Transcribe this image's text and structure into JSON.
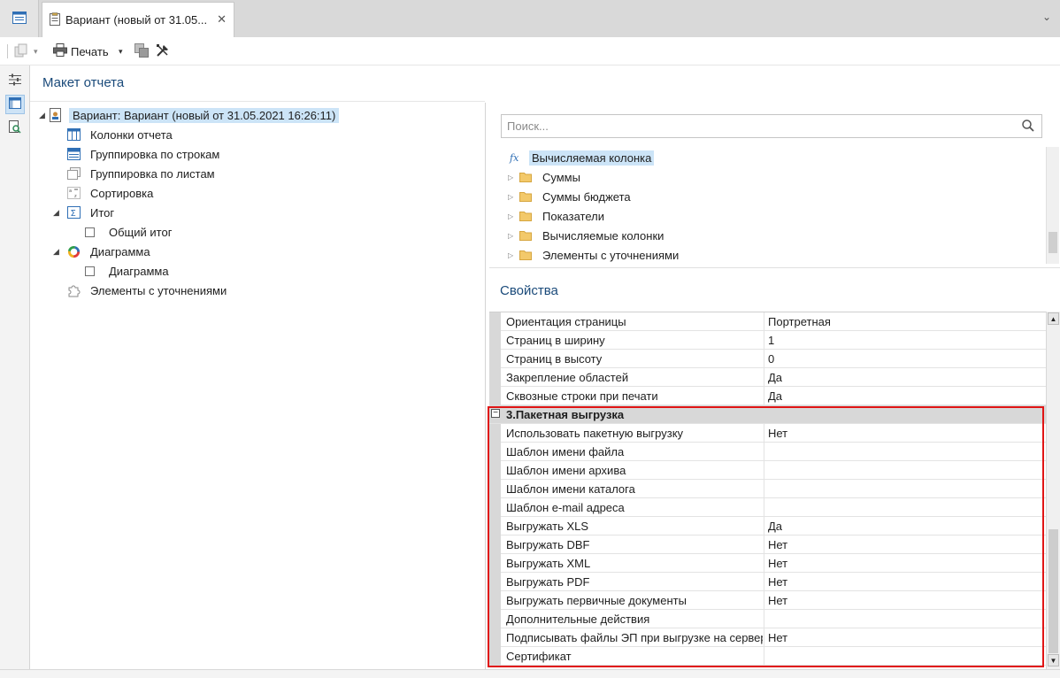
{
  "tabs": {
    "active_title": "Вариант (новый от 31.05...",
    "close_symbol": "✕",
    "chevron": "⌄"
  },
  "toolbar": {
    "print_label": "Печать",
    "dropdown_symbol": "▾"
  },
  "left_panel": {
    "title": "Макет отчета",
    "root": {
      "label": "Вариант: Вариант (новый от 31.05.2021 16:26:11)"
    },
    "items": [
      {
        "label": "Колонки отчета",
        "icon": "columns-icon"
      },
      {
        "label": "Группировка по строкам",
        "icon": "row-grouping-icon"
      },
      {
        "label": "Группировка по листам",
        "icon": "sheet-grouping-icon"
      },
      {
        "label": "Сортировка",
        "icon": "sort-icon"
      },
      {
        "label": "Итог",
        "icon": "sum-icon"
      },
      {
        "label": "Общий итог",
        "icon": "checkbox"
      },
      {
        "label": "Диаграмма",
        "icon": "chart-ring-icon"
      },
      {
        "label": "Диаграмма",
        "icon": "checkbox"
      },
      {
        "label": "Элементы с уточнениями",
        "icon": "puzzle-icon"
      }
    ]
  },
  "search": {
    "placeholder": "Поиск..."
  },
  "available": [
    {
      "label": "Вычисляемая колонка",
      "icon": "function-icon",
      "selected": true
    },
    {
      "label": "Суммы",
      "icon": "folder-icon"
    },
    {
      "label": "Суммы бюджета",
      "icon": "folder-icon"
    },
    {
      "label": "Показатели",
      "icon": "folder-icon"
    },
    {
      "label": "Вычисляемые колонки",
      "icon": "folder-icon"
    },
    {
      "label": "Элементы с уточнениями",
      "icon": "folder-icon"
    }
  ],
  "properties": {
    "title": "Свойства",
    "rows": [
      {
        "name": "Ориентация страницы",
        "value": "Портретная"
      },
      {
        "name": "Страниц в ширину",
        "value": "1"
      },
      {
        "name": "Страниц в высоту",
        "value": "0"
      },
      {
        "name": "Закрепление областей",
        "value": "Да"
      },
      {
        "name": "Сквозные строки при печати",
        "value": "Да"
      }
    ],
    "category": {
      "name": "3.Пакетная выгрузка",
      "collapse_symbol": "−"
    },
    "batch_rows": [
      {
        "name": "Использовать пакетную выгрузку",
        "value": "Нет"
      },
      {
        "name": "Шаблон имени файла",
        "value": ""
      },
      {
        "name": "Шаблон имени архива",
        "value": ""
      },
      {
        "name": "Шаблон имени каталога",
        "value": ""
      },
      {
        "name": "Шаблон e-mail адреса",
        "value": ""
      },
      {
        "name": "Выгружать XLS",
        "value": "Да"
      },
      {
        "name": "Выгружать DBF",
        "value": "Нет"
      },
      {
        "name": "Выгружать XML",
        "value": "Нет"
      },
      {
        "name": "Выгружать PDF",
        "value": "Нет"
      },
      {
        "name": "Выгружать первичные документы",
        "value": "Нет"
      },
      {
        "name": "Дополнительные действия",
        "value": ""
      },
      {
        "name": "Подписывать файлы ЭП при выгрузке на сервер",
        "value": "Нет"
      },
      {
        "name": "Сертификат",
        "value": ""
      }
    ]
  },
  "colors": {
    "accent": "#1a4a7a",
    "selection": "#cce4f7",
    "highlight_frame": "#e01515"
  }
}
